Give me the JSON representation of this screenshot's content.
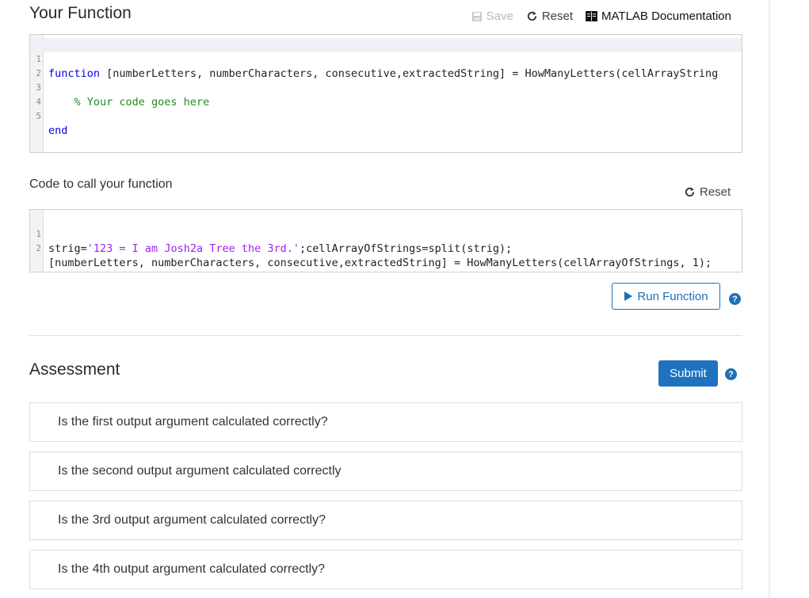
{
  "function_section": {
    "title": "Your Function",
    "toolbar": {
      "save": "Save",
      "reset": "Reset",
      "docs": "MATLAB Documentation"
    },
    "lines": [
      {
        "n": "1",
        "kw": "function",
        "text": " [numberLetters, numberCharacters, consecutive,extractedString] = HowManyLetters(cellArrayString"
      },
      {
        "n": "2",
        "text": ""
      },
      {
        "n": "3",
        "comment": "    % Your code goes here"
      },
      {
        "n": "4",
        "text": ""
      },
      {
        "n": "5",
        "kw": "end",
        "text": ""
      }
    ]
  },
  "call_section": {
    "label": "Code to call your function",
    "reset": "Reset",
    "lines": [
      {
        "n": "1",
        "pre": "strig=",
        "str": "'123 = I am Josh2a Tree the 3rd.'",
        "post": ";cellArrayOfStrings=split(strig);"
      },
      {
        "n": "2",
        "pre": "[numberLetters, numberCharacters, consecutive,extractedString] = HowManyLetters(cellArrayOfStrings, 1);"
      }
    ],
    "run_label": "Run Function",
    "help": "?"
  },
  "assessment": {
    "title": "Assessment",
    "submit_label": "Submit",
    "help": "?",
    "checks": [
      "Is the first output argument calculated correctly?",
      "Is the second output argument calculated correctly",
      "Is the 3rd output argument calculated correctly?",
      "Is the 4th output argument calculated correctly?"
    ]
  }
}
